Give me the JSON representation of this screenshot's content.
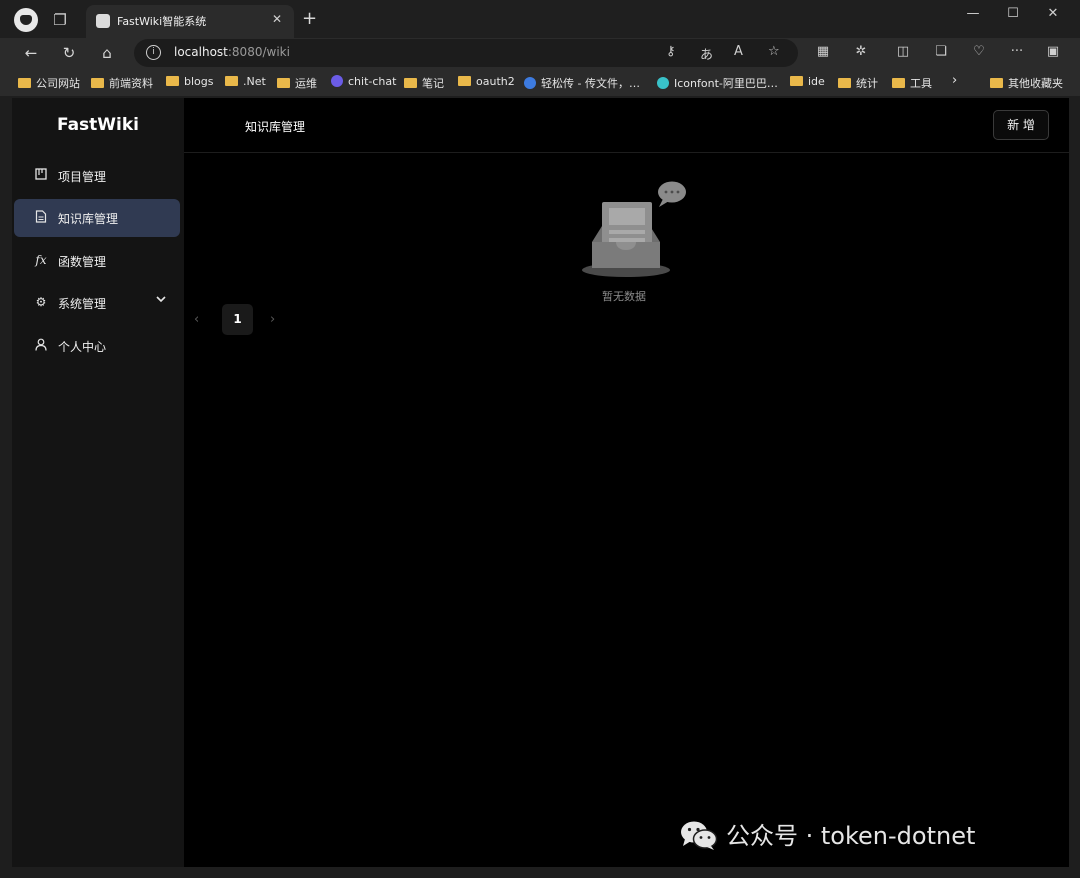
{
  "browser": {
    "tab_title": "FastWiki智能系统",
    "url_host": "localhost",
    "url_rest": ":8080/wiki"
  },
  "bookmarks": [
    {
      "label": "公司网站",
      "icon": "folder-icon"
    },
    {
      "label": "前端资料",
      "icon": "folder-icon"
    },
    {
      "label": "blogs",
      "icon": "folder-icon"
    },
    {
      "label": ".Net",
      "icon": "folder-icon"
    },
    {
      "label": "运维",
      "icon": "folder-icon"
    },
    {
      "label": "chit-chat",
      "icon": "chat-icon"
    },
    {
      "label": "笔记",
      "icon": "folder-icon"
    },
    {
      "label": "oauth2",
      "icon": "folder-icon"
    },
    {
      "label": "轻松传 - 传文件，…",
      "icon": "upload-icon"
    },
    {
      "label": "Iconfont-阿里巴巴…",
      "icon": "iconfont-icon"
    },
    {
      "label": "ide",
      "icon": "folder-icon"
    },
    {
      "label": "统计",
      "icon": "folder-icon"
    },
    {
      "label": "工具",
      "icon": "folder-icon"
    },
    {
      "label": "其他收藏夹",
      "icon": "folder-icon"
    }
  ],
  "app": {
    "logo": "FastWiki",
    "nav": [
      {
        "label": "项目管理",
        "icon": "project-icon"
      },
      {
        "label": "知识库管理",
        "icon": "document-icon",
        "active": true
      },
      {
        "label": "函数管理",
        "icon": "function-icon"
      },
      {
        "label": "系统管理",
        "icon": "gear-icon"
      },
      {
        "label": "个人中心",
        "icon": "user-icon"
      }
    ],
    "page_title": "知识库管理",
    "add_button": "新 增",
    "empty_text": "暂无数据",
    "pagination": {
      "current": "1"
    }
  },
  "watermark": "公众号 · token-dotnet",
  "colors": {
    "active_nav": "#303a52",
    "background": "#000000",
    "sidebar": "#141414"
  }
}
